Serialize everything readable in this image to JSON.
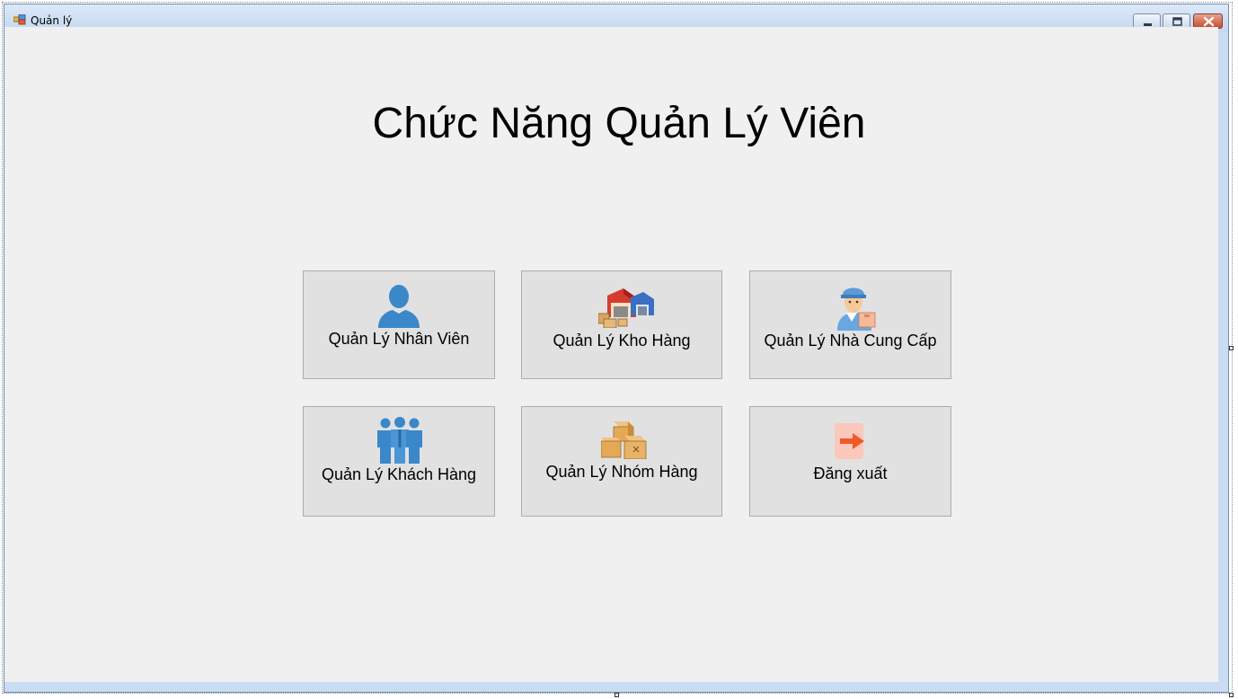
{
  "window": {
    "title": "Quản lý",
    "icon": "windows-form-icon",
    "controls": {
      "minimize": "minimize-icon",
      "maximize": "maximize-icon",
      "close": "close-icon"
    }
  },
  "main": {
    "heading": "Chức Năng Quản Lý Viên",
    "tiles": [
      {
        "label": "Quản Lý Nhân Viên",
        "icon": "person-icon"
      },
      {
        "label": "Quản Lý Kho Hàng",
        "icon": "warehouse-icon"
      },
      {
        "label": "Quản Lý Nhà Cung Cấp",
        "icon": "delivery-man-icon"
      },
      {
        "label": "Quản Lý Khách Hàng",
        "icon": "group-of-people-icon"
      },
      {
        "label": "Quản Lý Nhóm Hàng",
        "icon": "boxes-icon"
      },
      {
        "label": "Đăng xuất",
        "icon": "logout-arrow-icon"
      }
    ]
  },
  "colors": {
    "window_background": "#f0f0f0",
    "tile_background": "#e1e1e1",
    "tile_border": "#adadad",
    "icon_blue": "#3a87c9",
    "logout_arrow": "#f05a28"
  }
}
